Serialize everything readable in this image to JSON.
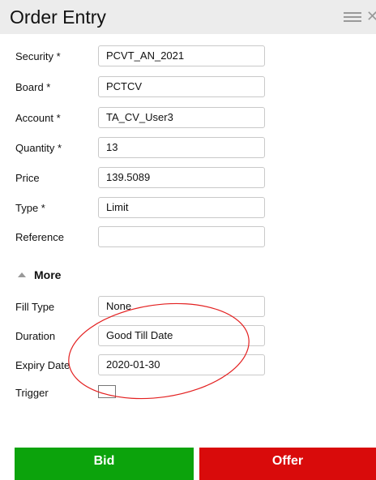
{
  "panel": {
    "title": "Order Entry",
    "menu_icon": "hamburger-icon",
    "close_icon": "close-icon"
  },
  "fields": [
    {
      "label": "Security *",
      "value": "PCVT_AN_2021"
    },
    {
      "label": "Board *",
      "value": "PCTCV"
    },
    {
      "label": "Account *",
      "value": "TA_CV_User3"
    },
    {
      "label": "Quantity *",
      "value": "13"
    },
    {
      "label": "Price",
      "value": "139.5089"
    },
    {
      "label": "Type *",
      "value": "Limit"
    },
    {
      "label": "Reference",
      "value": ""
    }
  ],
  "more": {
    "label": "More"
  },
  "extra_fields": [
    {
      "label": "Fill Type",
      "value": "None"
    },
    {
      "label": "Duration",
      "value": "Good Till Date"
    },
    {
      "label": "Expiry Date",
      "value": "2020-01-30"
    }
  ],
  "trigger": {
    "label": "Trigger",
    "checked": false
  },
  "buttons": {
    "bid": "Bid",
    "offer": "Offer"
  },
  "colors": {
    "bid": "#0ca30c",
    "offer": "#d90b0b",
    "annotation": "#e32020"
  }
}
